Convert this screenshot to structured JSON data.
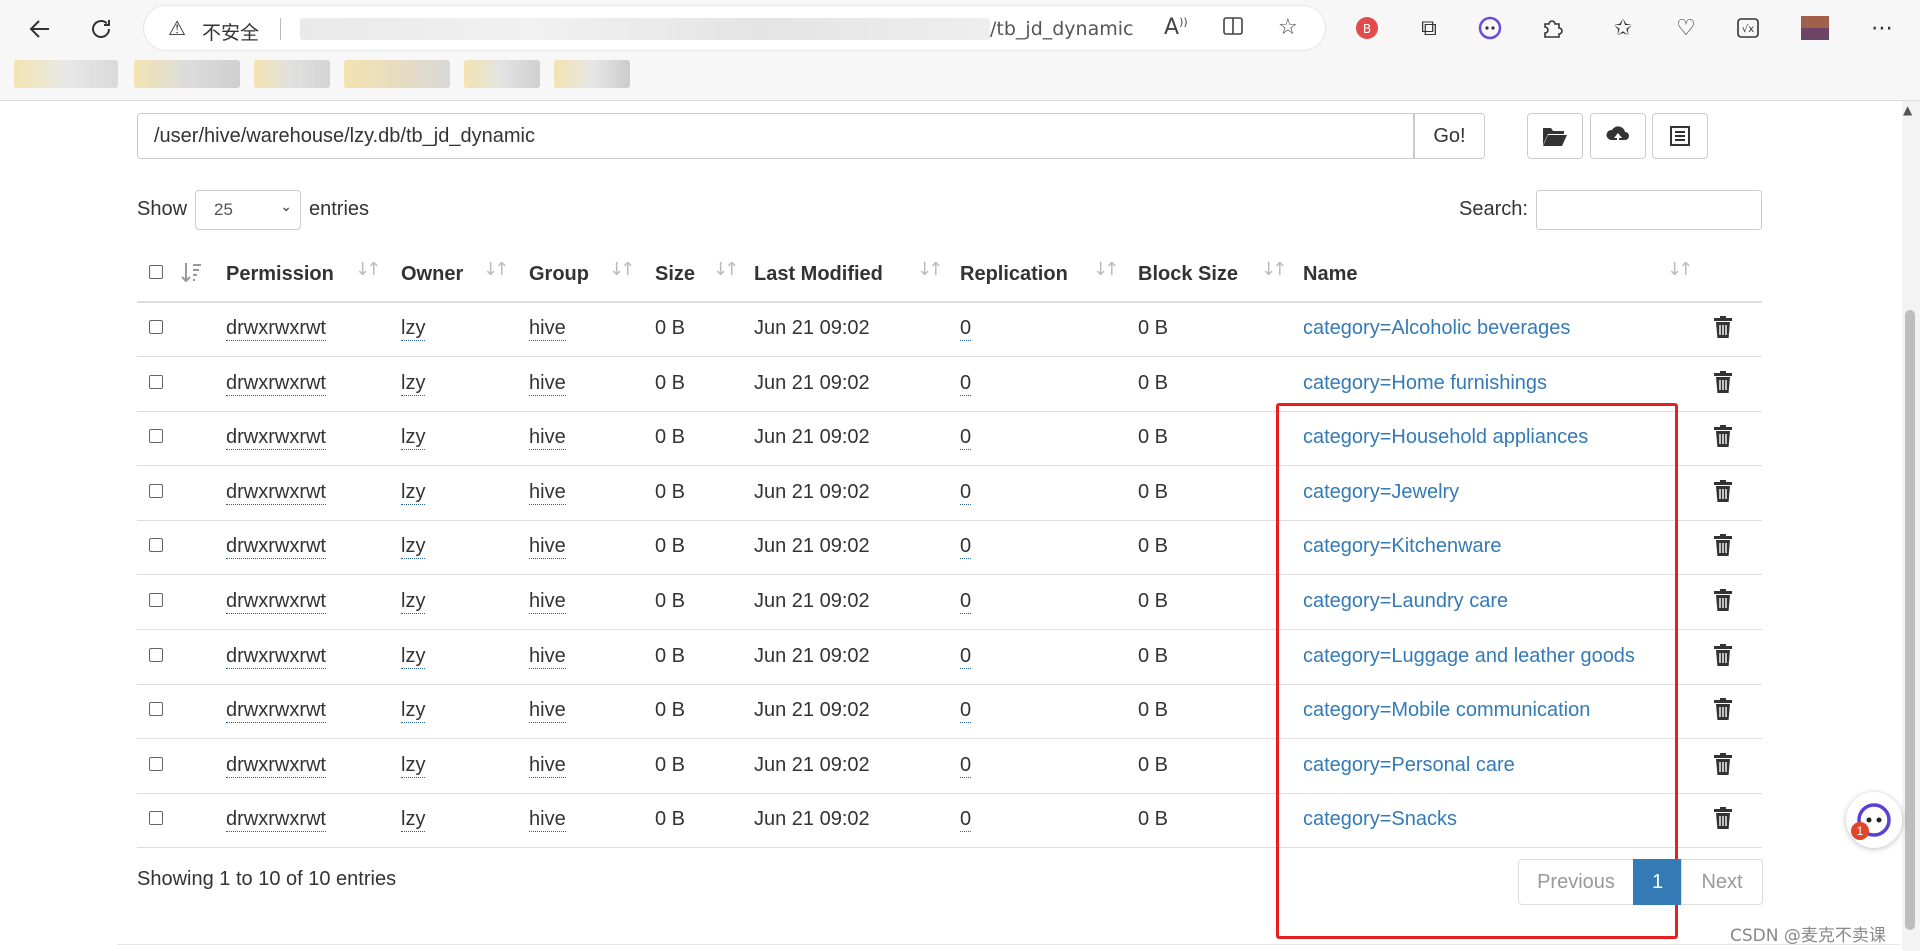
{
  "browser": {
    "security_label": "不安全",
    "url_tail": "/tb_jd_dynamic"
  },
  "path_bar": {
    "path": "/user/hive/warehouse/lzy.db/tb_jd_dynamic",
    "go_label": "Go!"
  },
  "length_menu": {
    "show_label": "Show",
    "selected": "25",
    "entries_label": "entries"
  },
  "search": {
    "label": "Search:",
    "value": ""
  },
  "table": {
    "headers": [
      "Permission",
      "Owner",
      "Group",
      "Size",
      "Last Modified",
      "Replication",
      "Block Size",
      "Name"
    ],
    "rows": [
      [
        "drwxrwxrwt",
        "lzy",
        "hive",
        "0 B",
        "Jun 21 09:02",
        "0",
        "0 B",
        "category=Alcoholic beverages"
      ],
      [
        "drwxrwxrwt",
        "lzy",
        "hive",
        "0 B",
        "Jun 21 09:02",
        "0",
        "0 B",
        "category=Home furnishings"
      ],
      [
        "drwxrwxrwt",
        "lzy",
        "hive",
        "0 B",
        "Jun 21 09:02",
        "0",
        "0 B",
        "category=Household appliances"
      ],
      [
        "drwxrwxrwt",
        "lzy",
        "hive",
        "0 B",
        "Jun 21 09:02",
        "0",
        "0 B",
        "category=Jewelry"
      ],
      [
        "drwxrwxrwt",
        "lzy",
        "hive",
        "0 B",
        "Jun 21 09:02",
        "0",
        "0 B",
        "category=Kitchenware"
      ],
      [
        "drwxrwxrwt",
        "lzy",
        "hive",
        "0 B",
        "Jun 21 09:02",
        "0",
        "0 B",
        "category=Laundry care"
      ],
      [
        "drwxrwxrwt",
        "lzy",
        "hive",
        "0 B",
        "Jun 21 09:02",
        "0",
        "0 B",
        "category=Luggage and leather goods"
      ],
      [
        "drwxrwxrwt",
        "lzy",
        "hive",
        "0 B",
        "Jun 21 09:02",
        "0",
        "0 B",
        "category=Mobile communication"
      ],
      [
        "drwxrwxrwt",
        "lzy",
        "hive",
        "0 B",
        "Jun 21 09:02",
        "0",
        "0 B",
        "category=Personal care"
      ],
      [
        "drwxrwxrwt",
        "lzy",
        "hive",
        "0 B",
        "Jun 21 09:02",
        "0",
        "0 B",
        "category=Snacks"
      ]
    ]
  },
  "footer": {
    "info": "Showing 1 to 10 of 10 entries",
    "previous": "Previous",
    "current_page": "1",
    "next": "Next"
  },
  "helper": {
    "badge": "1"
  },
  "watermark": "CSDN @麦克不卖课",
  "colors": {
    "link": "#337ab7",
    "highlight_border": "#e8201c",
    "active_page": "#337ab7"
  },
  "icons": [
    "back-icon",
    "refresh-icon",
    "warning-icon",
    "read-aloud-icon",
    "split-screen-icon",
    "favorite-star-icon",
    "folder-open-icon",
    "upload-icon",
    "list-icon",
    "trash-icon",
    "sort-icon"
  ]
}
